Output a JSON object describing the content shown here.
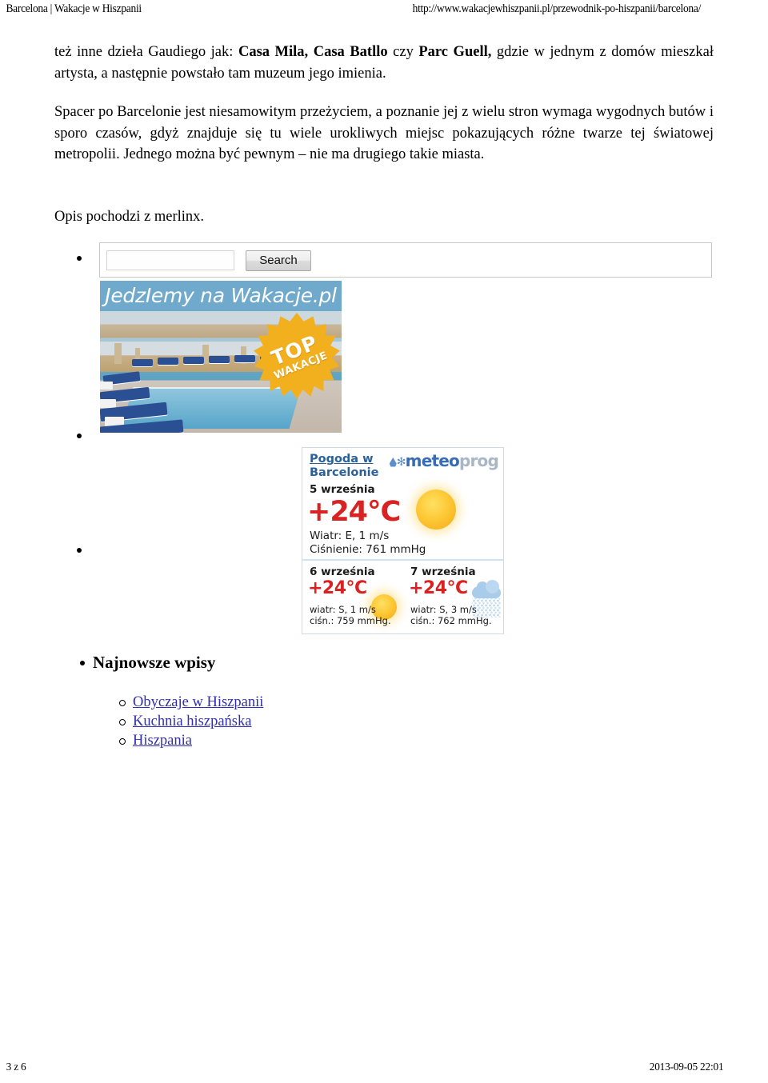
{
  "print_header": {
    "title": "Barcelona | Wakacje w Hiszpanii",
    "url": "http://www.wakacjewhiszpanii.pl/przewodnik-po-hiszpanii/barcelona/"
  },
  "article": {
    "paragraph1": {
      "lead": "też inne dzieła Gaudiego jak: ",
      "bold1": "Casa Mila, Casa Batllo",
      "mid": " czy ",
      "bold2": "Parc Guell,",
      "tail": " gdzie w jednym z domów mieszkał artysta, a następnie powstało tam muzeum jego imienia."
    },
    "paragraph2": "Spacer po Barcelonie jest niesamowitym przeżyciem, a poznanie jej z wielu stron wymaga wygodnych butów i sporo czasów, gdyż znajduje się tu wiele urokliwych miejsc pokazujących różne twarze tej światowej metropolii. Jednego można być pewnym – nie ma drugiego takie miasta.",
    "source_note": "Opis pochodzi z merlinx."
  },
  "search_widget": {
    "input_value": "",
    "input_placeholder": "",
    "button_label": "Search"
  },
  "banner_ad": {
    "brand_text": "JedzIemy na Wakacje.pl",
    "badge_line1": "TOP",
    "badge_line2": "WAKACJE",
    "bar_color": "#6fa9cc",
    "badge_color": "#f2b01e"
  },
  "weather": {
    "logo": {
      "name_bold": "meteo",
      "name_light": "prog"
    },
    "title_line1": "Pogoda w",
    "title_line2": "Barcelonie",
    "today": {
      "date": "5 września",
      "temperature": "+24°C",
      "wind": "Wiatr: E, 1 m/s",
      "pressure": "Ciśnienie: 761 mmHg",
      "icon": "sun-icon"
    },
    "forecast": [
      {
        "date": "6 września",
        "temperature": "+24°C",
        "wind": "wiatr: S, 1 m/s",
        "pressure": "ciśn.: 759 mmHg.",
        "icon": "sun-icon"
      },
      {
        "date": "7 września",
        "temperature": "+24°C",
        "wind": "wiatr: S, 3 m/s",
        "pressure": "ciśn.: 762 mmHg.",
        "icon": "rain-cloud-icon"
      }
    ],
    "accent_temp_color": "#d92222",
    "accent_title_color": "#2c6099"
  },
  "latest_posts": {
    "heading": "Najnowsze wpisy",
    "items": [
      "Obyczaje w Hiszpanii",
      "Kuchnia hiszpańska",
      "Hiszpania"
    ],
    "link_color": "#2f2fb0"
  },
  "print_footer": {
    "page": "3 z 6",
    "timestamp": "2013-09-05 22:01"
  }
}
